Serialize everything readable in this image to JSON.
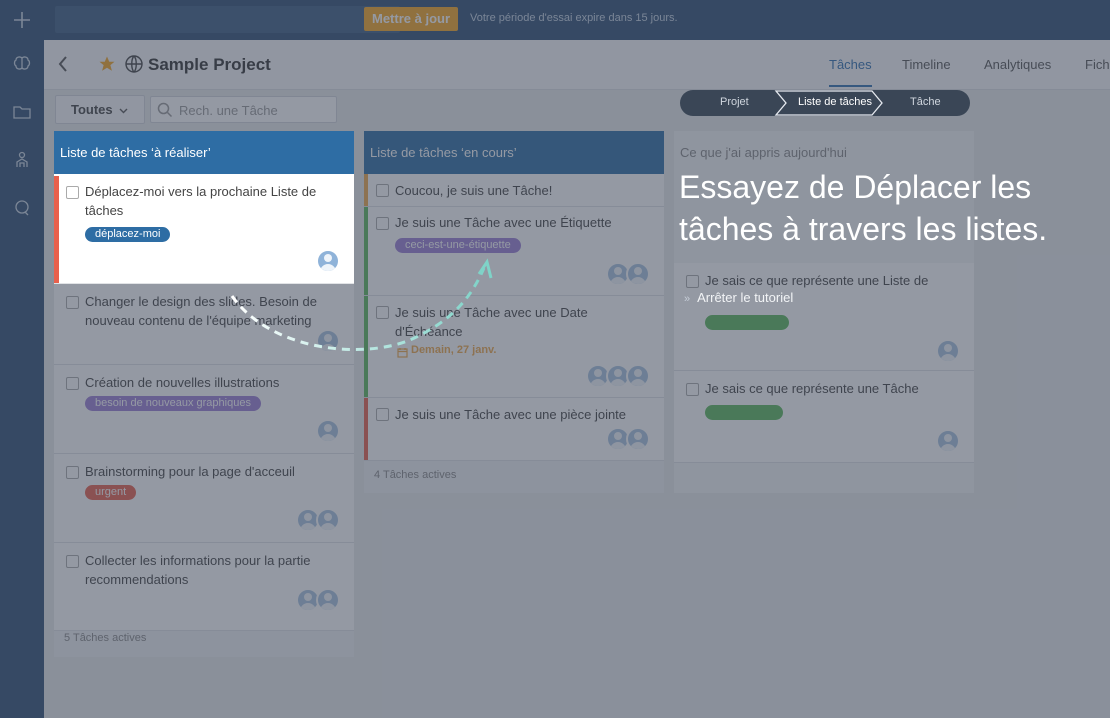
{
  "topbar": {
    "upgrade_label": "Mettre à jour",
    "trial_text": "Votre période d'essai expire dans 15 jours."
  },
  "project": {
    "title": "Sample Project",
    "tabs": [
      "Tâches",
      "Timeline",
      "Analytiques",
      "Fich"
    ],
    "active_tab": "Tâches"
  },
  "filter": {
    "label": "Toutes",
    "search_placeholder": "Rech. une Tâche"
  },
  "breadcrumbs": [
    "Projet",
    "Liste de tâches",
    "Tâche"
  ],
  "tutorial": {
    "line1": "Essayez de Déplacer les",
    "line2": "tâches à travers les listes.",
    "stop_label": "Arrêter le tutoriel"
  },
  "lists": [
    {
      "title": "Liste de tâches ‘à réaliser’",
      "footer": "5 Tâches actives",
      "tasks": [
        {
          "line1": "Déplacez-moi vers la prochaine Liste de",
          "line2": "tâches",
          "tag": "déplacez-moi"
        },
        {
          "line1": "Changer le design des slides. Besoin de",
          "line2": "nouveau contenu de l'équipe marketing"
        },
        {
          "line1": "Création de nouvelles illustrations",
          "tag": "besoin de nouveaux graphiques"
        },
        {
          "line1": "Brainstorming pour la page d'acceuil",
          "tag": "urgent"
        },
        {
          "line1": "Collecter les informations pour la partie",
          "line2": "recommendations"
        }
      ]
    },
    {
      "title": "Liste de tâches ‘en cours’",
      "footer": "4 Tâches actives",
      "tasks": [
        {
          "line1": "Coucou, je suis une Tâche!"
        },
        {
          "line1": "Je suis une Tâche avec une Étiquette",
          "tag": "ceci-est-une-étiquette"
        },
        {
          "line1": "Je suis une Tâche avec une Date",
          "line2": "d'Échéance",
          "due": "Demain, 27 janv."
        },
        {
          "line1": "Je suis une Tâche avec une pièce jointe"
        }
      ]
    },
    {
      "title": "Ce que j'ai appris aujourd'hui",
      "tasks": [
        {
          "line1": "Je sais ce que représente une Liste de"
        },
        {
          "line1": "Je sais ce que représente une Tâche"
        }
      ]
    }
  ],
  "colors": {
    "brand": "#2f4e73",
    "list_header": "#2e6da4",
    "upgrade": "#f5a623",
    "stripe_red": "#e8604c",
    "stripe_orange": "#f0a94a",
    "stripe_green": "#5cb85c",
    "tag_blue": "#2e6da4",
    "tag_purple": "#9b7fd4",
    "tag_red": "#e8604c",
    "tag_green": "#5cb85c"
  }
}
